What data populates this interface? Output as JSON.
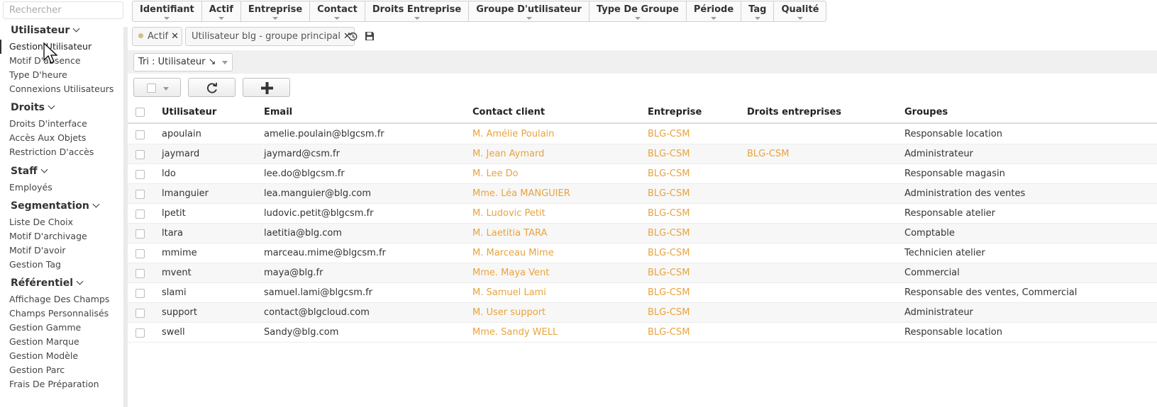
{
  "search": {
    "placeholder": "Rechercher"
  },
  "sidebar": {
    "sections": [
      {
        "title": "Utilisateur",
        "items": [
          "Gestion Utilisateur",
          "Motif D'absence",
          "Type D'heure",
          "Connexions Utilisateurs"
        ]
      },
      {
        "title": "Droits",
        "items": [
          "Droits D'interface",
          "Accès Aux Objets",
          "Restriction D'accès"
        ]
      },
      {
        "title": "Staff",
        "items": [
          "Employés"
        ]
      },
      {
        "title": "Segmentation",
        "items": [
          "Liste De Choix",
          "Motif D'archivage",
          "Motif D'avoir",
          "Gestion Tag"
        ]
      },
      {
        "title": "Référentiel",
        "items": [
          "Affichage Des Champs",
          "Champs Personnalisés",
          "Gestion Gamme",
          "Gestion Marque",
          "Gestion Modèle",
          "Gestion Parc",
          "Frais De Préparation"
        ]
      }
    ]
  },
  "filter_tabs": [
    "Identifiant",
    "Actif",
    "Entreprise",
    "Contact",
    "Droits Entreprise",
    "Groupe D'utilisateur",
    "Type De Groupe",
    "Période",
    "Tag",
    "Qualité"
  ],
  "active_filters": [
    {
      "label": "Actif"
    },
    {
      "label": "Utilisateur blg - groupe principal"
    }
  ],
  "sort": {
    "label": "Tri : Utilisateur ↘"
  },
  "colors": {
    "link": "#e8a33d",
    "row_alt": "#f7f7f7"
  },
  "table": {
    "columns": [
      "Utilisateur",
      "Email",
      "Contact client",
      "Entreprise",
      "Droits entreprises",
      "Groupes"
    ],
    "rows": [
      {
        "user": "apoulain",
        "email": "amelie.poulain@blgcsm.fr",
        "contact": "M. Amélie Poulain",
        "company": "BLG-CSM",
        "rights": "",
        "groups": "Responsable location"
      },
      {
        "user": "jaymard",
        "email": "jaymard@csm.fr",
        "contact": "M. Jean Aymard",
        "company": "BLG-CSM",
        "rights": "BLG-CSM",
        "groups": "Administrateur"
      },
      {
        "user": "ldo",
        "email": "lee.do@blgcsm.fr",
        "contact": "M. Lee Do",
        "company": "BLG-CSM",
        "rights": "",
        "groups": "Responsable magasin"
      },
      {
        "user": "lmanguier",
        "email": "lea.manguier@blg.com",
        "contact": "Mme. Léa MANGUIER",
        "company": "BLG-CSM",
        "rights": "",
        "groups": "Administration des ventes"
      },
      {
        "user": "lpetit",
        "email": "ludovic.petit@blgcsm.fr",
        "contact": "M. Ludovic Petit",
        "company": "BLG-CSM",
        "rights": "",
        "groups": "Responsable atelier"
      },
      {
        "user": "ltara",
        "email": "laetitia@blg.com",
        "contact": "M. Laetitia TARA",
        "company": "BLG-CSM",
        "rights": "",
        "groups": "Comptable"
      },
      {
        "user": "mmime",
        "email": "marceau.mime@blgcsm.fr",
        "contact": "M. Marceau Mime",
        "company": "BLG-CSM",
        "rights": "",
        "groups": "Technicien atelier"
      },
      {
        "user": "mvent",
        "email": "maya@blg.fr",
        "contact": "Mme. Maya Vent",
        "company": "BLG-CSM",
        "rights": "",
        "groups": "Commercial"
      },
      {
        "user": "slami",
        "email": "samuel.lami@blgcsm.fr",
        "contact": "M. Samuel Lami",
        "company": "BLG-CSM",
        "rights": "",
        "groups": "Responsable des ventes, Commercial"
      },
      {
        "user": "support",
        "email": "contact@blgcloud.com",
        "contact": "M. User support",
        "company": "BLG-CSM",
        "rights": "",
        "groups": "Administrateur"
      },
      {
        "user": "swell",
        "email": "Sandy@blg.com",
        "contact": "Mme. Sandy WELL",
        "company": "BLG-CSM",
        "rights": "",
        "groups": "Responsable location"
      }
    ]
  }
}
